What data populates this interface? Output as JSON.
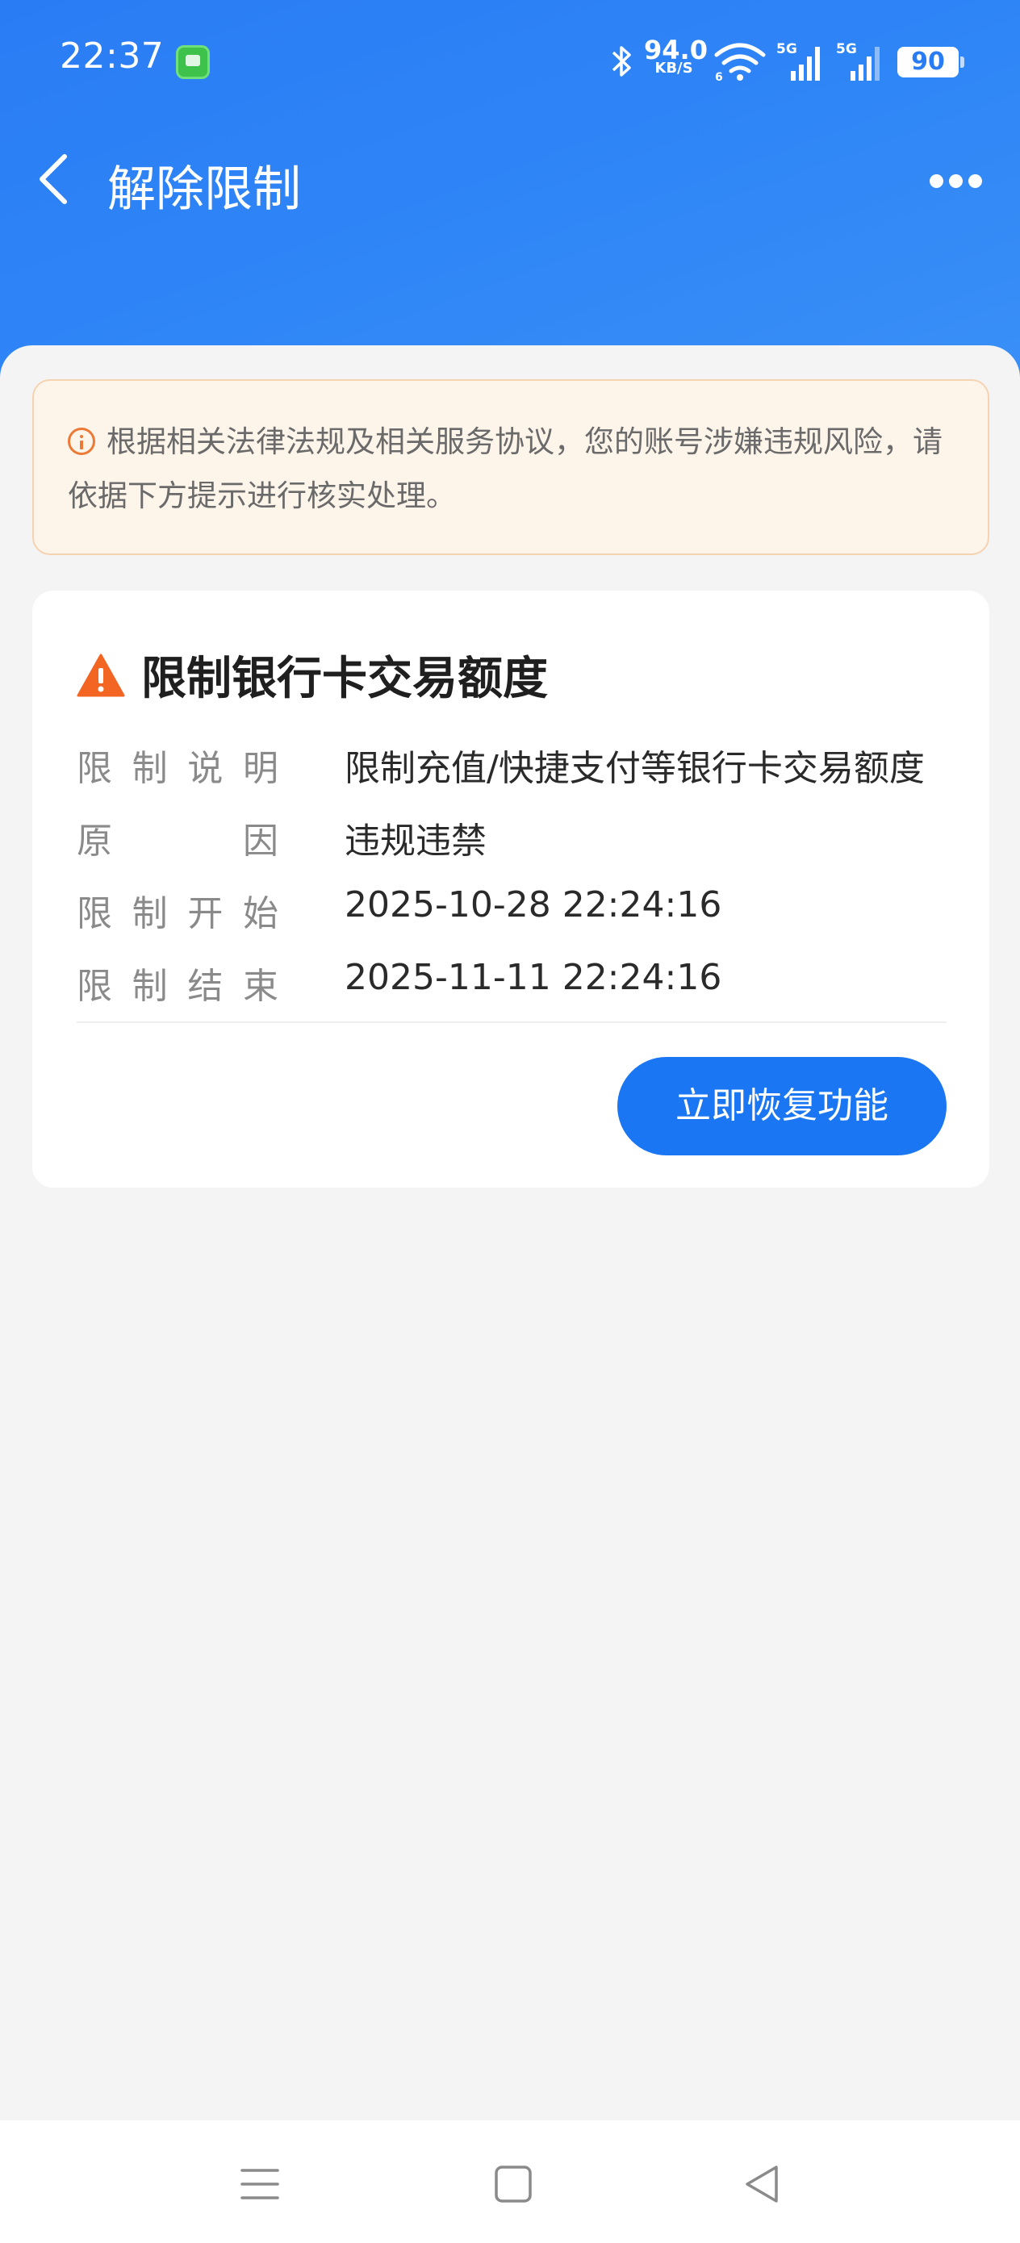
{
  "status_bar": {
    "time": "22:37",
    "net_speed_value": "94.0",
    "net_speed_unit": "KB/S",
    "battery_level": "90",
    "icons": [
      "chat-app-icon",
      "bluetooth-icon",
      "wifi-icon",
      "signal-5g-icon",
      "signal-5g-icon",
      "battery-icon"
    ]
  },
  "nav": {
    "title": "解除限制",
    "back_icon": "chevron-left-icon",
    "more_icon": "more-dots-icon"
  },
  "notice": {
    "icon": "info-icon",
    "text": "根据相关法律法规及相关服务协议，您的账号涉嫌违规风险，请依据下方提示进行核实处理。"
  },
  "restriction": {
    "icon": "warning-icon",
    "title": "限制银行卡交易额度",
    "rows": [
      {
        "label": "限制说明",
        "value": "限制充值/快捷支付等银行卡交易额度"
      },
      {
        "label": "原因",
        "value": "违规违禁"
      },
      {
        "label": "限制开始",
        "value": "2025-10-28 22:24:16"
      },
      {
        "label": "限制结束",
        "value": "2025-11-11 22:24:16"
      }
    ],
    "button_label": "立即恢复功能"
  },
  "system_nav": {
    "icons": [
      "menu-icon",
      "home-icon",
      "back-triangle-icon"
    ]
  },
  "colors": {
    "header_blue": "#2a7cf4",
    "button_blue": "#1a76f2",
    "warning_orange": "#f26522",
    "notice_bg": "#fdf4ea"
  }
}
